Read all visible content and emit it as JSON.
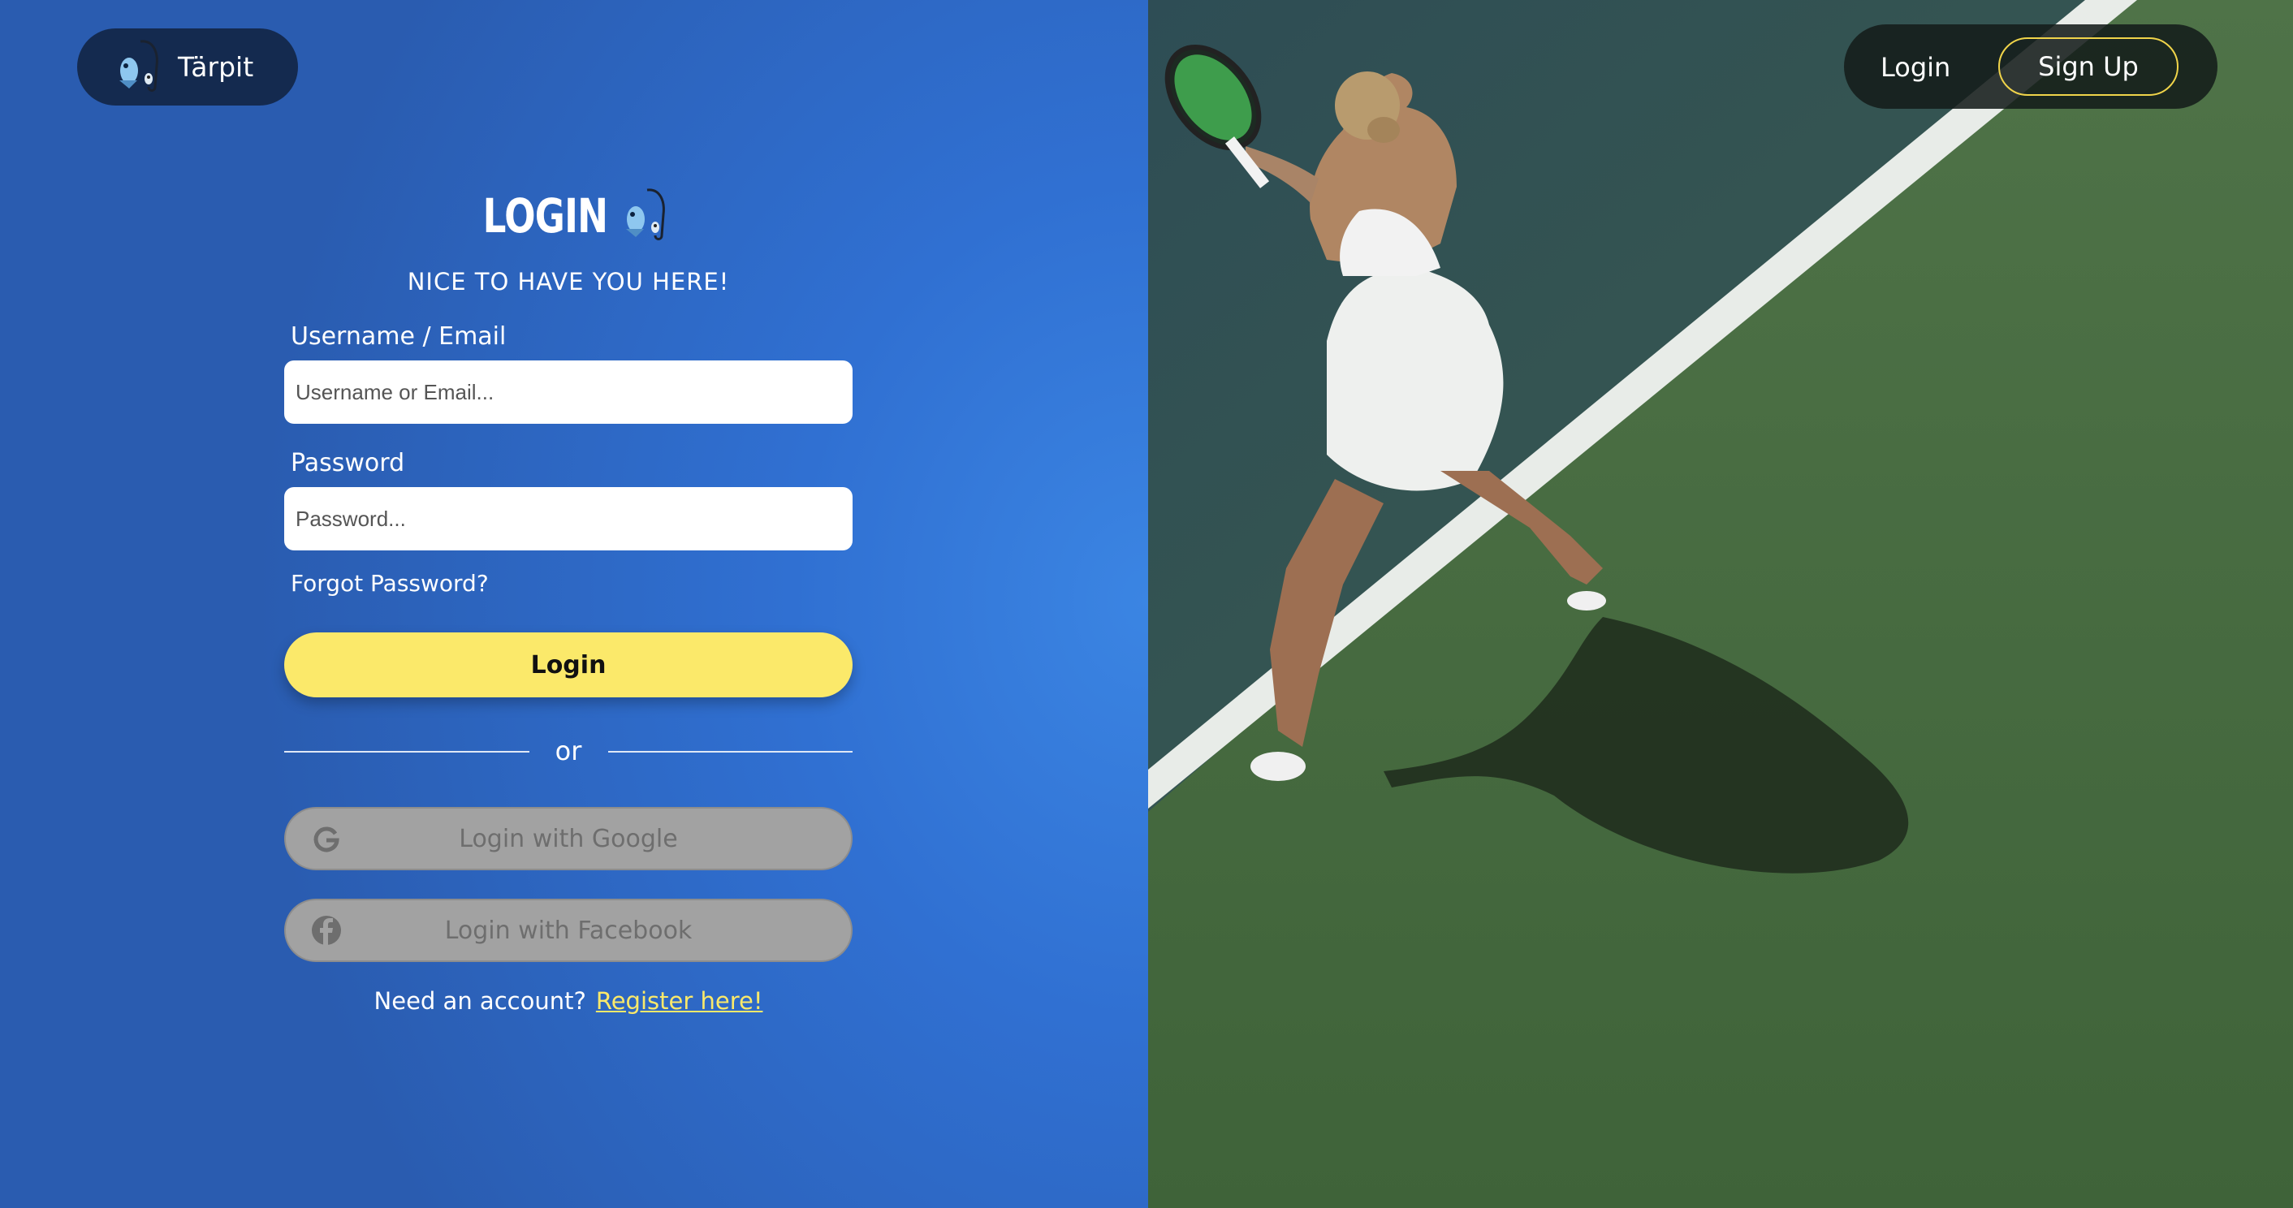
{
  "brand": {
    "name": "Tärpit",
    "logo_icon": "fish-hook-icon"
  },
  "nav": {
    "login_label": "Login",
    "signup_label": "Sign Up"
  },
  "form": {
    "title": "LOGIN",
    "subtitle": "NICE TO HAVE YOU HERE!",
    "username_label": "Username / Email",
    "username_placeholder": "Username or Email...",
    "password_label": "Password",
    "password_placeholder": "Password...",
    "forgot_label": "Forgot Password?",
    "login_button": "Login",
    "divider_text": "or",
    "google_button": "Login with Google",
    "facebook_button": "Login with Facebook",
    "need_account_text": "Need an account?",
    "register_link": "Register here!"
  },
  "colors": {
    "primary_blue": "#3070d2",
    "accent_yellow": "#fbe96a",
    "brand_dark": "#142a4f",
    "social_gray": "#a2a2a2"
  },
  "hero_image": {
    "subject": "tennis-player-on-court-photo"
  }
}
